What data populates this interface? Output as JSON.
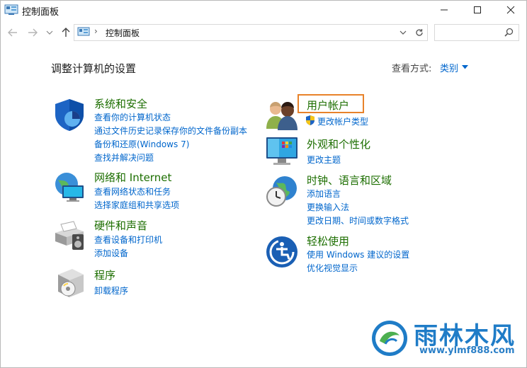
{
  "window": {
    "title": "控制面板"
  },
  "address": {
    "path": "控制面板",
    "search_placeholder": ""
  },
  "content": {
    "title": "调整计算机的设置",
    "view_by_label": "查看方式:",
    "view_by_value": "类别"
  },
  "categories": {
    "system_security": {
      "title": "系统和安全",
      "links": [
        "查看你的计算机状态",
        "通过文件历史记录保存你的文件备份副本",
        "备份和还原(Windows 7)",
        "查找并解决问题"
      ]
    },
    "network_internet": {
      "title": "网络和 Internet",
      "links": [
        "查看网络状态和任务",
        "选择家庭组和共享选项"
      ]
    },
    "hardware_sound": {
      "title": "硬件和声音",
      "links": [
        "查看设备和打印机",
        "添加设备"
      ]
    },
    "programs": {
      "title": "程序",
      "links": [
        "卸载程序"
      ]
    },
    "user_accounts": {
      "title": "用户帐户",
      "links": [
        "更改帐户类型"
      ]
    },
    "appearance": {
      "title": "外观和个性化",
      "links": [
        "更改主题"
      ]
    },
    "clock_region": {
      "title": "时钟、语言和区域",
      "links": [
        "添加语言",
        "更换输入法",
        "更改日期、时间或数字格式"
      ]
    },
    "ease_of_access": {
      "title": "轻松使用",
      "links": [
        "使用 Windows 建议的设置",
        "优化视觉显示"
      ]
    }
  },
  "watermark": {
    "brand": "雨林木风",
    "url": "www.ylmf888.com"
  },
  "colors": {
    "link": "#0066cc",
    "category_title": "#1c6e00",
    "highlight": "#e8822a"
  }
}
